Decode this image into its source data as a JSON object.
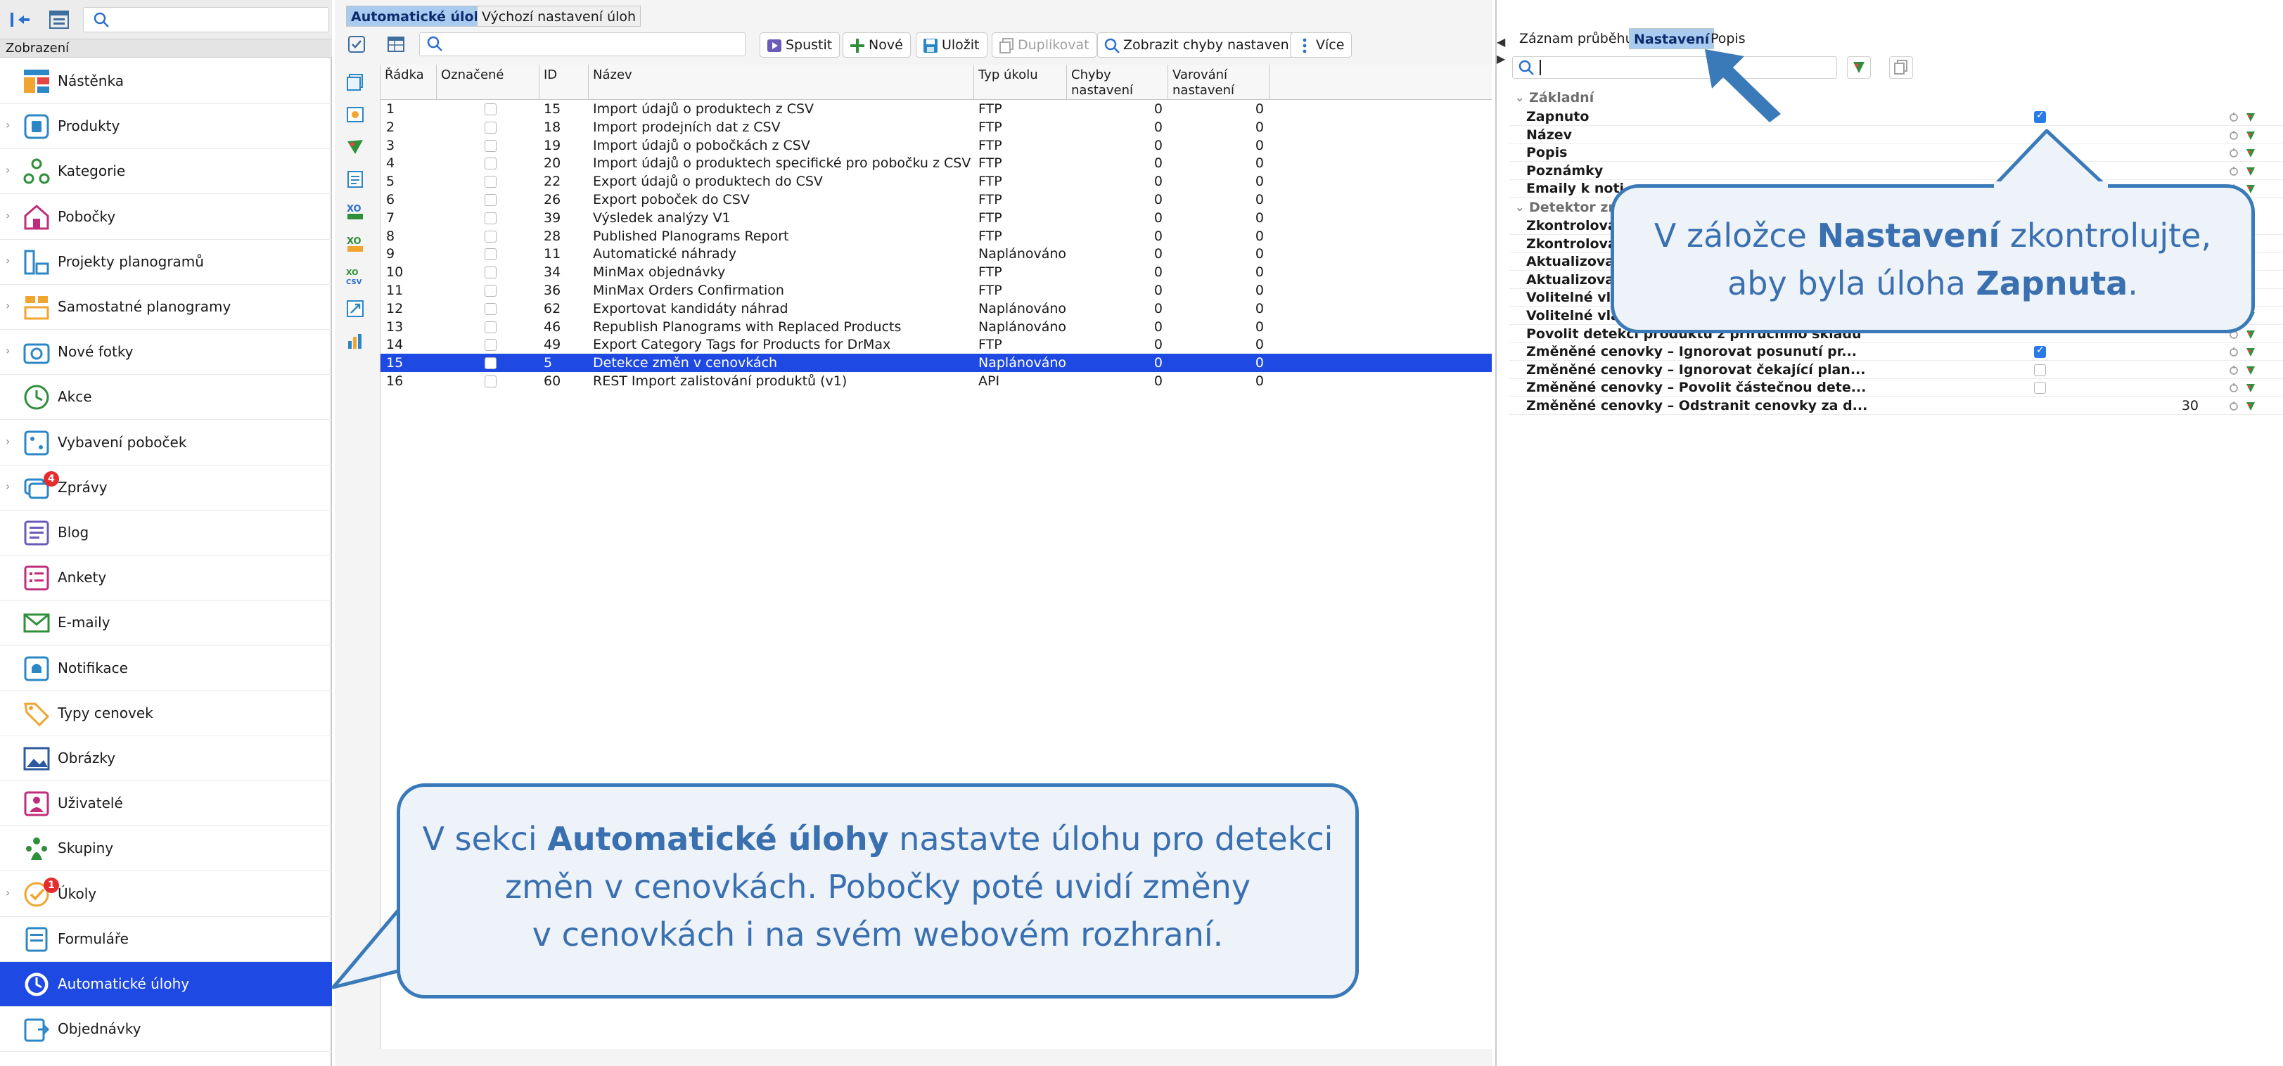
{
  "sidebar": {
    "search_placeholder": "",
    "section_label": "Zobrazení",
    "items": [
      {
        "label": "Nástěnka",
        "icon": "dashboard-icon",
        "has_children": false,
        "badge": ""
      },
      {
        "label": "Produkty",
        "icon": "product-icon",
        "has_children": true,
        "badge": ""
      },
      {
        "label": "Kategorie",
        "icon": "category-icon",
        "has_children": true,
        "badge": ""
      },
      {
        "label": "Pobočky",
        "icon": "store-icon",
        "has_children": true,
        "badge": ""
      },
      {
        "label": "Projekty planogramů",
        "icon": "planogram-project-icon",
        "has_children": true,
        "badge": ""
      },
      {
        "label": "Samostatné planogramy",
        "icon": "planogram-icon",
        "has_children": true,
        "badge": ""
      },
      {
        "label": "Nové fotky",
        "icon": "camera-icon",
        "has_children": true,
        "badge": ""
      },
      {
        "label": "Akce",
        "icon": "clock-icon",
        "has_children": false,
        "badge": ""
      },
      {
        "label": "Vybavení poboček",
        "icon": "equipment-icon",
        "has_children": true,
        "badge": ""
      },
      {
        "label": "Zprávy",
        "icon": "messages-icon",
        "has_children": true,
        "badge": "4"
      },
      {
        "label": "Blog",
        "icon": "blog-icon",
        "has_children": false,
        "badge": ""
      },
      {
        "label": "Ankety",
        "icon": "survey-icon",
        "has_children": false,
        "badge": ""
      },
      {
        "label": "E-maily",
        "icon": "email-icon",
        "has_children": false,
        "badge": ""
      },
      {
        "label": "Notifikace",
        "icon": "notification-icon",
        "has_children": false,
        "badge": ""
      },
      {
        "label": "Typy cenovek",
        "icon": "price-tag-icon",
        "has_children": false,
        "badge": ""
      },
      {
        "label": "Obrázky",
        "icon": "image-icon",
        "has_children": false,
        "badge": ""
      },
      {
        "label": "Uživatelé",
        "icon": "user-icon",
        "has_children": false,
        "badge": ""
      },
      {
        "label": "Skupiny",
        "icon": "group-icon",
        "has_children": false,
        "badge": ""
      },
      {
        "label": "Úkoly",
        "icon": "task-icon",
        "has_children": true,
        "badge": "1"
      },
      {
        "label": "Formuláře",
        "icon": "form-icon",
        "has_children": false,
        "badge": ""
      },
      {
        "label": "Automatické úlohy",
        "icon": "automatic-task-icon",
        "has_children": false,
        "badge": "",
        "active": true
      },
      {
        "label": "Objednávky",
        "icon": "order-icon",
        "has_children": false,
        "badge": ""
      }
    ]
  },
  "center": {
    "tabs": [
      {
        "label": "Automatické úlohy",
        "active": true
      },
      {
        "label": "Výchozí nastavení úloh",
        "active": false
      }
    ],
    "search_placeholder": "",
    "toolbar": {
      "run": "Spustit",
      "new": "Nové",
      "save": "Uložit",
      "duplicate": "Duplikovat",
      "show_errors": "Zobrazit chyby nastavení",
      "more": "Více"
    },
    "columns": {
      "row": "Řádka",
      "marked": "Označené",
      "id": "ID",
      "name": "Název",
      "type": "Typ úkolu",
      "errors": "Chyby nastavení",
      "warnings": "Varování nastavení"
    },
    "rows": [
      {
        "row": "1",
        "id": "15",
        "name": "Import údajů o produktech z CSV",
        "type": "FTP",
        "errors": "0",
        "warnings": "0"
      },
      {
        "row": "2",
        "id": "18",
        "name": "Import prodejních dat z CSV",
        "type": "FTP",
        "errors": "0",
        "warnings": "0"
      },
      {
        "row": "3",
        "id": "19",
        "name": "Import údajů o pobočkách z CSV",
        "type": "FTP",
        "errors": "0",
        "warnings": "0"
      },
      {
        "row": "4",
        "id": "20",
        "name": "Import údajů o produktech specifické pro pobočku z CSV",
        "type": "FTP",
        "errors": "0",
        "warnings": "0"
      },
      {
        "row": "5",
        "id": "22",
        "name": "Export údajů o produktech do CSV",
        "type": "FTP",
        "errors": "0",
        "warnings": "0"
      },
      {
        "row": "6",
        "id": "26",
        "name": "Export poboček do CSV",
        "type": "FTP",
        "errors": "0",
        "warnings": "0"
      },
      {
        "row": "7",
        "id": "39",
        "name": "Výsledek analýzy V1",
        "type": "FTP",
        "errors": "0",
        "warnings": "0"
      },
      {
        "row": "8",
        "id": "28",
        "name": "Published Planograms Report",
        "type": "FTP",
        "errors": "0",
        "warnings": "0"
      },
      {
        "row": "9",
        "id": "11",
        "name": "Automatické náhrady",
        "type": "Naplánováno",
        "errors": "0",
        "warnings": "0"
      },
      {
        "row": "10",
        "id": "34",
        "name": "MinMax objednávky",
        "type": "FTP",
        "errors": "0",
        "warnings": "0"
      },
      {
        "row": "11",
        "id": "36",
        "name": "MinMax Orders Confirmation",
        "type": "FTP",
        "errors": "0",
        "warnings": "0"
      },
      {
        "row": "12",
        "id": "62",
        "name": "Exportovat kandidáty náhrad",
        "type": "Naplánováno",
        "errors": "0",
        "warnings": "0"
      },
      {
        "row": "13",
        "id": "46",
        "name": "Republish Planograms with Replaced Products",
        "type": "Naplánováno",
        "errors": "0",
        "warnings": "0"
      },
      {
        "row": "14",
        "id": "49",
        "name": "Export Category Tags for Products for DrMax",
        "type": "FTP",
        "errors": "0",
        "warnings": "0"
      },
      {
        "row": "15",
        "id": "5",
        "name": "Detekce změn v cenovkách",
        "type": "Naplánováno",
        "errors": "0",
        "warnings": "0",
        "selected": true
      },
      {
        "row": "16",
        "id": "60",
        "name": "REST Import zalistování produktů (v1)",
        "type": "API",
        "errors": "0",
        "warnings": "0"
      }
    ]
  },
  "right": {
    "tabs": [
      {
        "label": "Záznam průběhu",
        "active": false
      },
      {
        "label": "Nastavení",
        "active": true
      },
      {
        "label": "Popis",
        "active": false
      }
    ],
    "search_placeholder": "",
    "group_basic": "Základní",
    "group_detector": "Detektor zn",
    "props_basic": [
      {
        "label": "Zapnuto",
        "checkbox": true,
        "checked": true,
        "value": ""
      },
      {
        "label": "Název",
        "checkbox": false,
        "checked": false,
        "value": ""
      },
      {
        "label": "Popis",
        "checkbox": false,
        "checked": false,
        "value": ""
      },
      {
        "label": "Poznámky",
        "checkbox": false,
        "checked": false,
        "value": ""
      },
      {
        "label": "Emaily k noti",
        "checkbox": false,
        "checked": false,
        "value": ""
      }
    ],
    "props_detector": [
      {
        "label": "Zkontrolova",
        "checkbox": false,
        "checked": false,
        "value": ""
      },
      {
        "label": "Zkontrolova",
        "checkbox": false,
        "checked": false,
        "value": ""
      },
      {
        "label": "Aktualizova",
        "checkbox": false,
        "checked": false,
        "value": ""
      },
      {
        "label": "Aktualizova",
        "checkbox": false,
        "checked": false,
        "value": ""
      },
      {
        "label": "Volitelné vla",
        "checkbox": false,
        "checked": false,
        "value": ""
      },
      {
        "label": "Volitelné vla",
        "checkbox": false,
        "checked": false,
        "value": ""
      },
      {
        "label": "Povolit detekci produktu z příručního skladu",
        "checkbox": false,
        "checked": false,
        "value": ""
      },
      {
        "label": "Změněné cenovky – Ignorovat posunutí pr...",
        "checkbox": true,
        "checked": true,
        "value": ""
      },
      {
        "label": "Změněné cenovky – Ignorovat čekající plan...",
        "checkbox": true,
        "checked": false,
        "value": ""
      },
      {
        "label": "Změněné cenovky – Povolit částečnou dete...",
        "checkbox": true,
        "checked": false,
        "value": ""
      },
      {
        "label": "Změněné cenovky – Odstranit cenovky za d...",
        "checkbox": false,
        "checked": false,
        "value": "30"
      }
    ]
  },
  "callouts": {
    "bottom": {
      "p1": "V sekci ",
      "b1": "Automatické úlohy",
      "p2": " nastavte úlohu pro detekci",
      "line2": "změn v cenovkách. Pobočky poté uvidí změny",
      "line3": "v cenovkách i na svém webovém rozhraní."
    },
    "right": {
      "p1": "V záložce ",
      "b1": "Nastavení",
      "p2": " zkontrolujte,",
      "p3": "aby byla úloha ",
      "b2": "Zapnuta",
      "p4": "."
    }
  },
  "colors": {
    "selection": "#1e49e2",
    "callout_border": "#3a7ab9",
    "callout_fill": "#edf3f9",
    "tab_active": "#a8cbef",
    "badge": "#e62c2c",
    "checkbox": "#2a7ae6"
  }
}
